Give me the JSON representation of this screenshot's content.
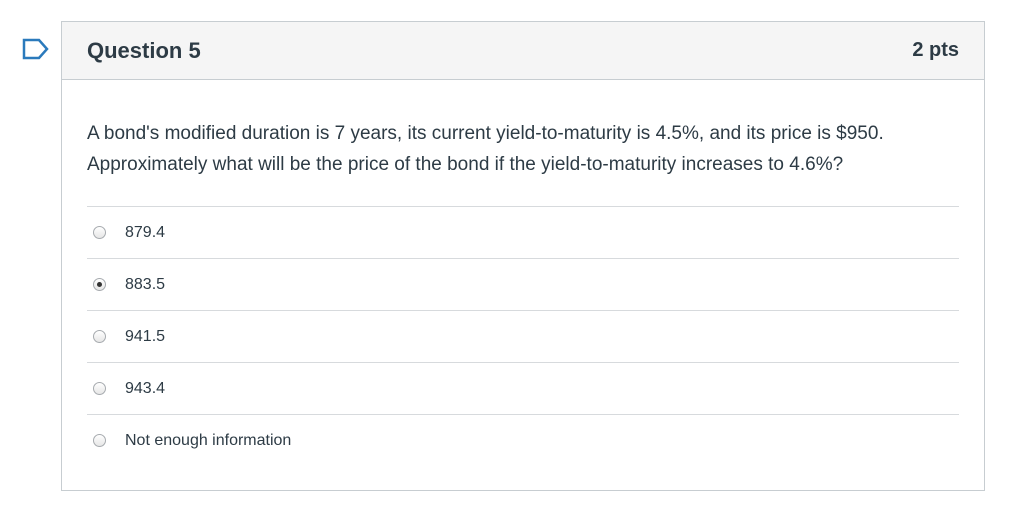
{
  "question": {
    "title": "Question 5",
    "points": "2 pts",
    "text_line1": "A bond's modified duration is 7 years, its current yield-to-maturity is 4.5%, and its price is $950.",
    "text_line2": "Approximately what will be the price of the bond if the yield-to-maturity increases to 4.6%?",
    "flag_icon": "bookmark-flag-icon",
    "answers": [
      {
        "label": "879.4",
        "selected": false
      },
      {
        "label": "883.5",
        "selected": true
      },
      {
        "label": "941.5",
        "selected": false
      },
      {
        "label": "943.4",
        "selected": false
      },
      {
        "label": "Not enough information",
        "selected": false
      }
    ]
  },
  "colors": {
    "flag": "#2b7abc",
    "text": "#2d3b45",
    "header_bg": "#f5f5f5",
    "border": "#c7cdd1"
  }
}
